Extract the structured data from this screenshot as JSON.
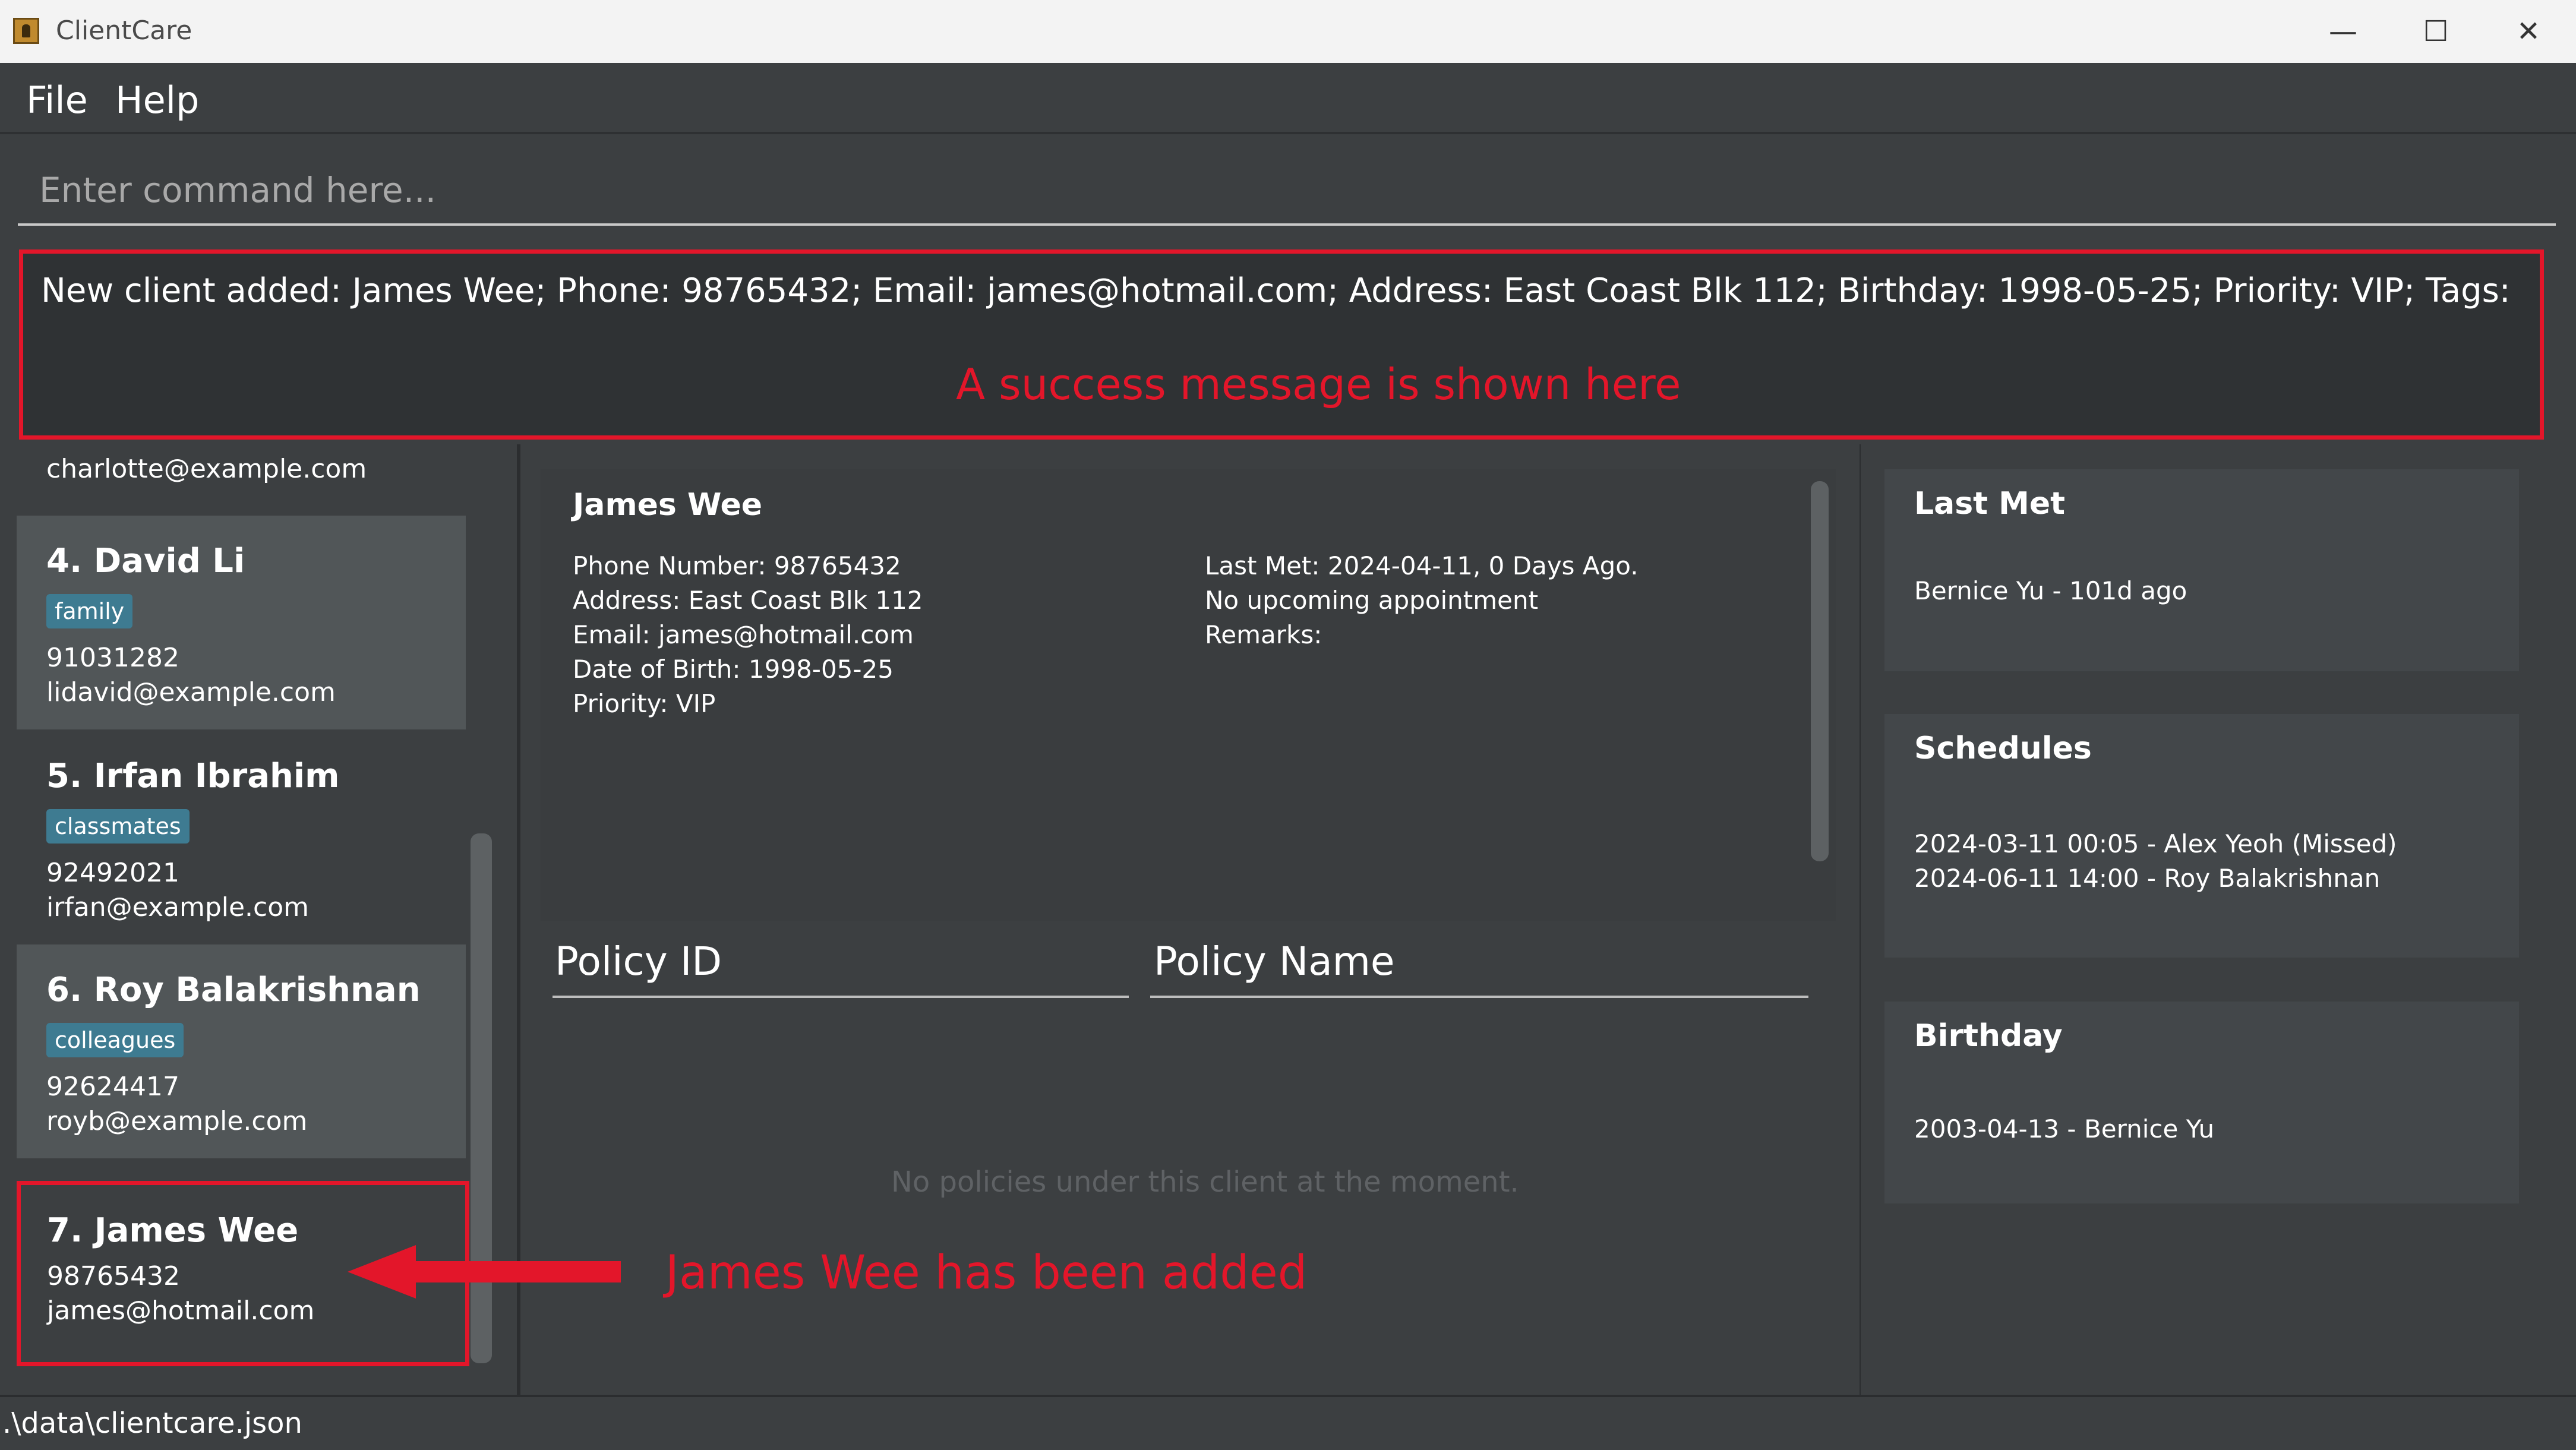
{
  "window": {
    "title": "ClientCare",
    "minimize": "—",
    "maximize": "☐",
    "close": "✕"
  },
  "menu": {
    "file": "File",
    "help": "Help"
  },
  "command": {
    "placeholder": "Enter command here..."
  },
  "result": {
    "message": "New client added: James Wee; Phone: 98765432; Email: james@hotmail.com; Address: East Coast Blk 112; Birthday: 1998-05-25; Priority: VIP; Tags:"
  },
  "annotations": {
    "success": "A success message is shown here",
    "added": "James Wee has been added"
  },
  "client_list": {
    "cut_email": "charlotte@example.com",
    "items": [
      {
        "name": "4.  David Li",
        "tag": "family",
        "phone": "91031282",
        "email": "lidavid@example.com"
      },
      {
        "name": "5.  Irfan Ibrahim",
        "tag": "classmates",
        "phone": "92492021",
        "email": "irfan@example.com"
      },
      {
        "name": "6.  Roy Balakrishnan",
        "tag": "colleagues",
        "phone": "92624417",
        "email": "royb@example.com"
      },
      {
        "name": "7.  James Wee",
        "phone": "98765432",
        "email": "james@hotmail.com"
      }
    ]
  },
  "detail": {
    "name": "James Wee",
    "phone": "Phone Number: 98765432",
    "address": "Address: East Coast Blk 112",
    "email": "Email: james@hotmail.com",
    "dob": "Date of Birth: 1998-05-25",
    "priority": "Priority: VIP",
    "last_met": "Last Met: 2024-04-11, 0 Days Ago.",
    "appointment": "No upcoming appointment",
    "remarks": "Remarks:"
  },
  "policy_table": {
    "col_id": "Policy ID",
    "col_name": "Policy Name",
    "empty": "No policies under this client at the moment."
  },
  "side_panels": {
    "last_met": {
      "title": "Last Met",
      "lines": [
        "Bernice Yu - 101d ago"
      ]
    },
    "schedules": {
      "title": "Schedules",
      "lines": [
        "2024-03-11 00:05 - Alex Yeoh (Missed)",
        "2024-06-11 14:00 - Roy Balakrishnan"
      ]
    },
    "birthday": {
      "title": "Birthday",
      "lines": [
        "2003-04-13 - Bernice Yu"
      ]
    }
  },
  "status": {
    "path": ".\\data\\clientcare.json"
  },
  "colors": {
    "accent_red": "#e3162a",
    "tag_blue": "#3e7b91",
    "background": "#3c3f41"
  }
}
